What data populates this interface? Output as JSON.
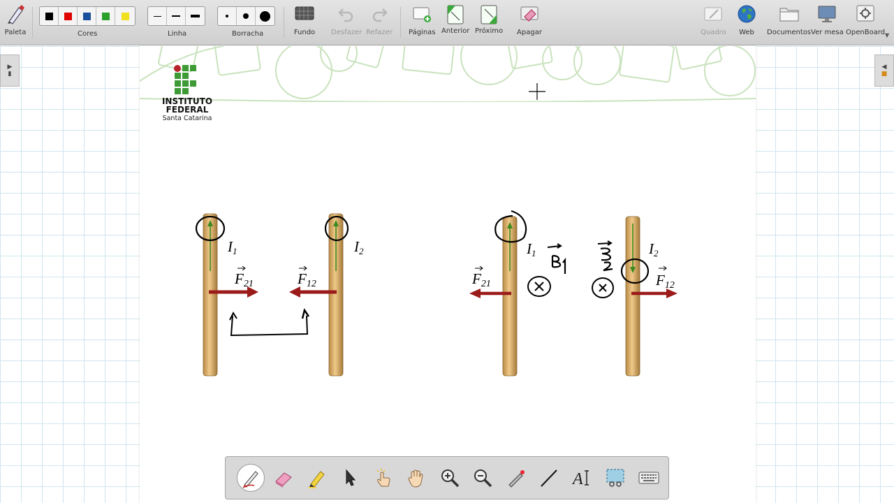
{
  "toolbar": {
    "paleta": "Paleta",
    "cores": "Cores",
    "linha": "Linha",
    "borracha": "Borracha",
    "fundo": "Fundo",
    "desfazer": "Desfazer",
    "refazer": "Refazer",
    "paginas": "Páginas",
    "anterior": "Anterior",
    "proximo": "Próximo",
    "apagar": "Apagar",
    "quadro": "Quadro",
    "web": "Web",
    "documentos": "Documentos",
    "ver_mesa": "Ver mesa",
    "openboard": "OpenBoard",
    "colors": [
      "#000000",
      "#e00000",
      "#1a4f9c",
      "#2aa02a",
      "#f0e020"
    ]
  },
  "logo": {
    "line1": "INSTITUTO",
    "line2": "FEDERAL",
    "line3": "Santa Catarina"
  },
  "diagram": {
    "left": {
      "current1": "I",
      "sub1": "1",
      "current2": "I",
      "sub2": "2",
      "force21": "F",
      "sub21": "21",
      "force12": "F",
      "sub12": "12"
    },
    "right": {
      "current1": "I",
      "sub1": "1",
      "current2": "I",
      "sub2": "2",
      "force21": "F",
      "sub21": "21",
      "force12": "F",
      "sub12": "12"
    }
  },
  "dock": {
    "tools": [
      "pen-tool",
      "eraser-tool",
      "marker-tool",
      "selector-tool",
      "interact-tool",
      "hand-tool",
      "zoom-in-tool",
      "zoom-out-tool",
      "laser-pointer-tool",
      "line-tool",
      "text-tool",
      "capture-tool",
      "keyboard-tool"
    ]
  }
}
